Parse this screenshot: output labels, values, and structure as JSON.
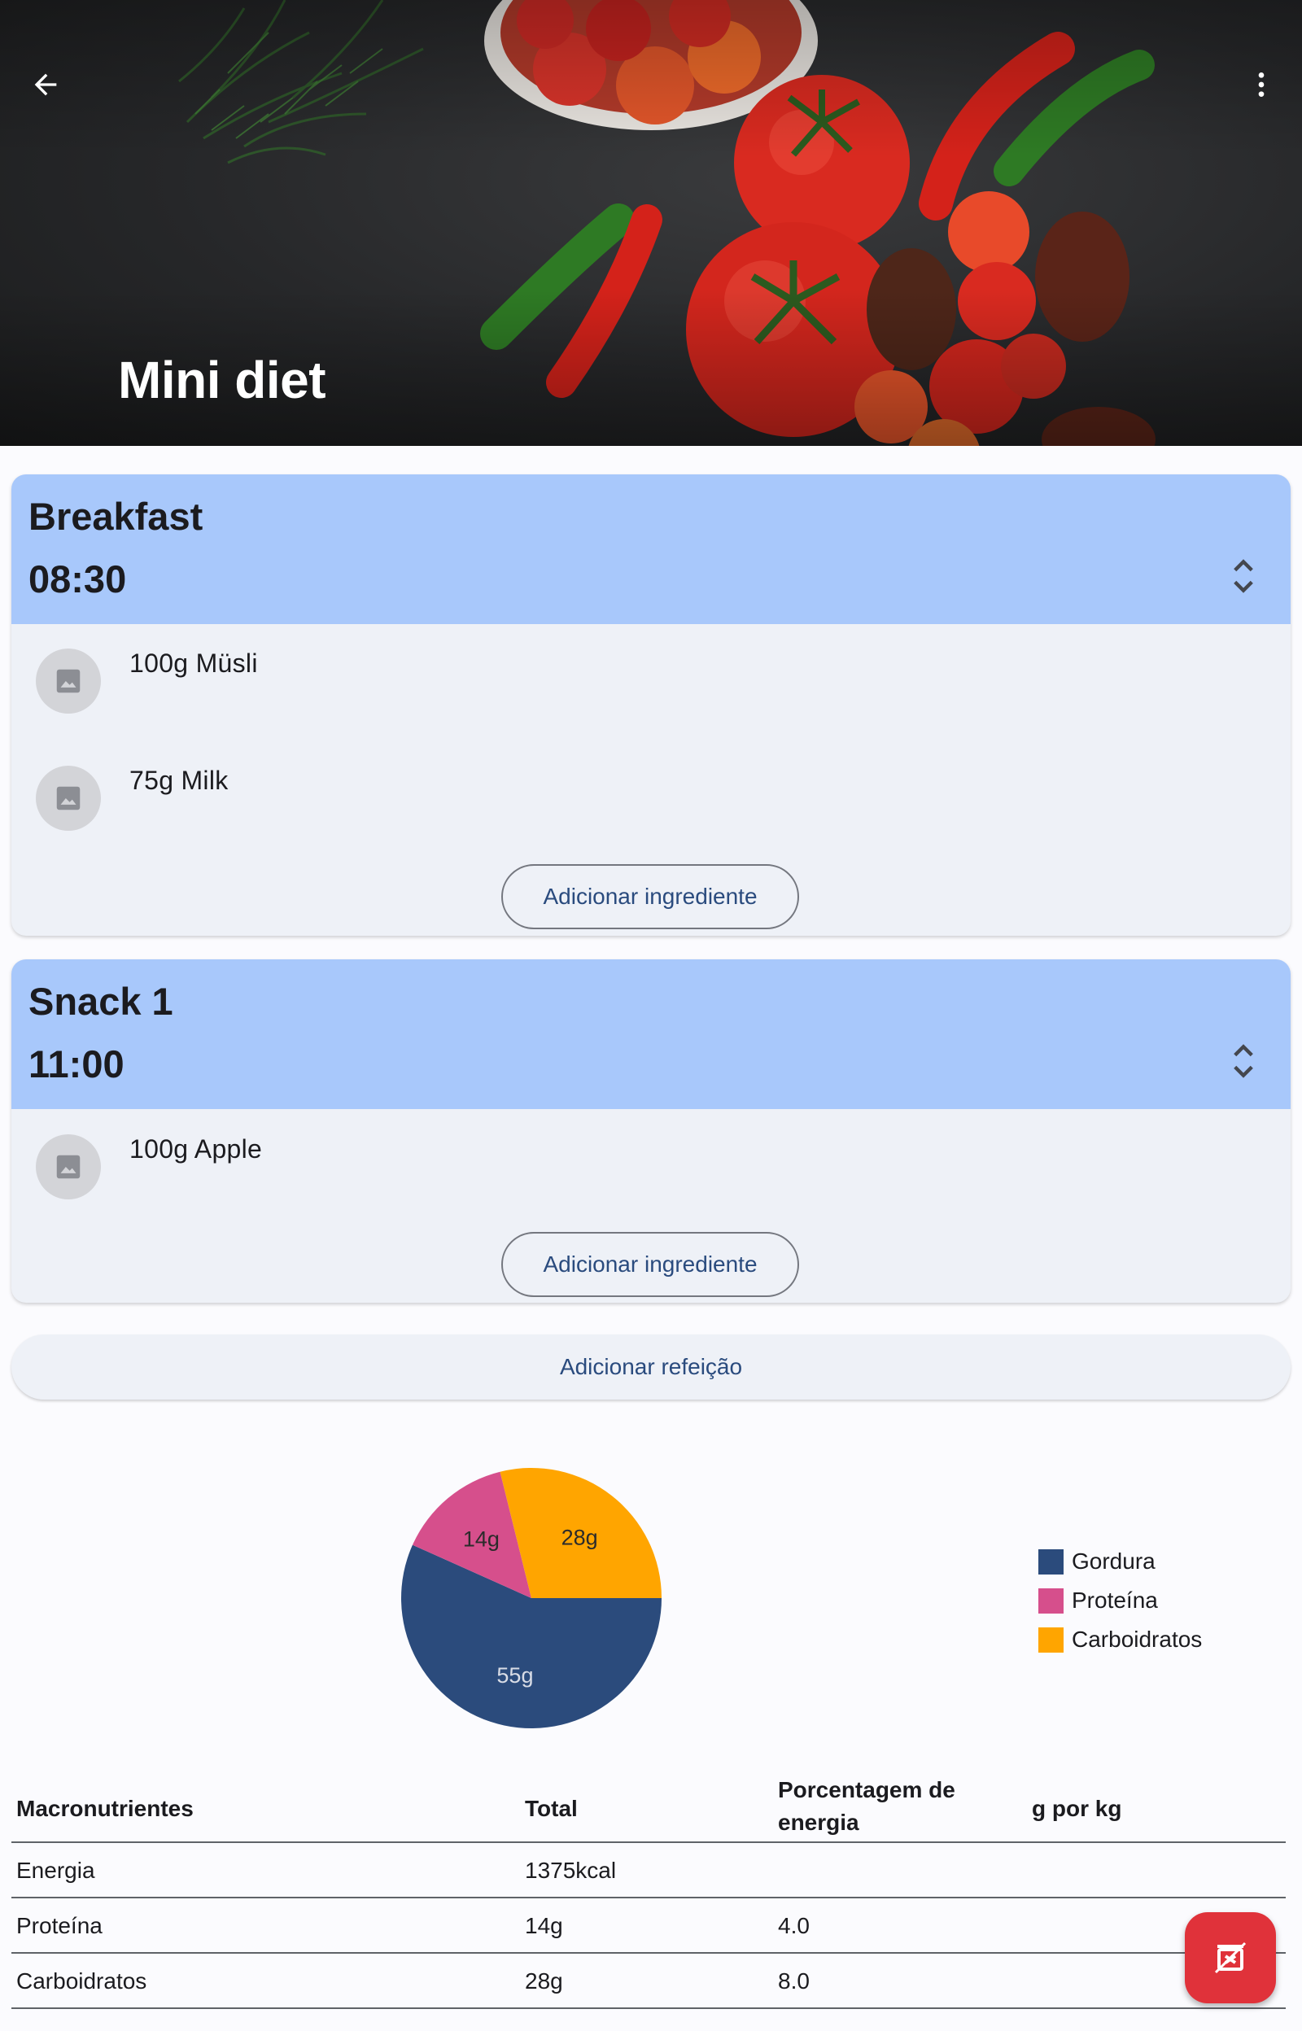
{
  "header": {
    "title": "Mini diet",
    "back_icon": "arrow-left-icon",
    "menu_icon": "more-vert-icon"
  },
  "meals": [
    {
      "name": "Breakfast",
      "time": "08:30",
      "ingredients": [
        {
          "label": "100g Müsli"
        },
        {
          "label": "75g Milk"
        }
      ],
      "add_ingredient_label": "Adicionar ingrediente"
    },
    {
      "name": "Snack 1",
      "time": "11:00",
      "ingredients": [
        {
          "label": "100g Apple"
        }
      ],
      "add_ingredient_label": "Adicionar ingrediente"
    }
  ],
  "add_meal_label": "Adicionar refeição",
  "chart_data": {
    "type": "pie",
    "unit": "g",
    "series": [
      {
        "name": "Gordura",
        "value": 55,
        "label": "55g",
        "color": "#2b4b7c"
      },
      {
        "name": "Proteína",
        "value": 14,
        "label": "14g",
        "color": "#d64f8c"
      },
      {
        "name": "Carboidratos",
        "value": 28,
        "label": "28g",
        "color": "#ffa500"
      }
    ],
    "legend_position": "right"
  },
  "table": {
    "headers": [
      "Macronutrientes",
      "Total",
      "Porcentagem de energia",
      "g por kg"
    ],
    "rows": [
      [
        "Energia",
        "1375kcal",
        "",
        ""
      ],
      [
        "Proteína",
        "14g",
        "4.0",
        ""
      ],
      [
        "Carboidratos",
        "28g",
        "8.0",
        ""
      ]
    ]
  },
  "colors": {
    "meal_header": "#a8c8fb",
    "card_bg": "#eef1f7",
    "primary_text": "#2a4b7e",
    "fab": "#e0323a"
  },
  "fab_icon": "log-meal-icon"
}
